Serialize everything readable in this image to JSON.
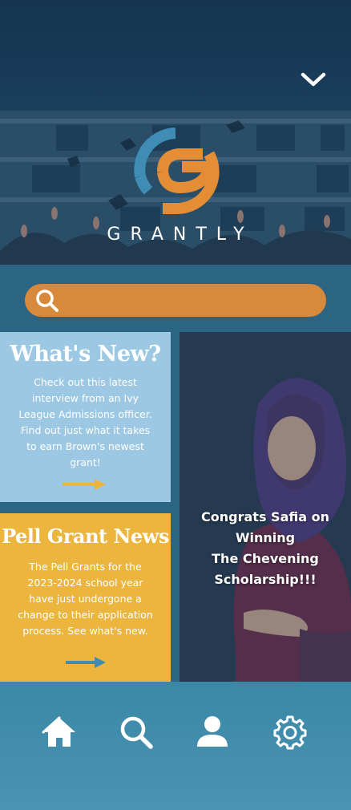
{
  "app": {
    "name": "GRANTLY"
  },
  "header": {
    "menu_icon": "chevron-down-icon"
  },
  "search": {
    "placeholder": "",
    "icon": "search-icon"
  },
  "cards": [
    {
      "title": "What's New?",
      "body": "Check out this latest interview from an Ivy League Admissions officer. Find out just what it takes to earn Brown's newest grant!",
      "arrow_icon": "arrow-right-icon",
      "arrow_color": "#ebb53e"
    },
    {
      "title": "Pell Grant News",
      "body": "The Pell Grants for the 2023-2024 school year have just undergone a change to their application process. See what's new.",
      "arrow_icon": "arrow-right-icon",
      "arrow_color": "#3f8db5"
    }
  ],
  "feature": {
    "line1": "Congrats Safia on",
    "line2": "Winning",
    "line3": "The Chevening",
    "line4": "Scholarship!!!"
  },
  "bottom_nav": [
    {
      "icon": "home-icon"
    },
    {
      "icon": "search-icon"
    },
    {
      "icon": "profile-icon"
    },
    {
      "icon": "settings-icon"
    }
  ],
  "colors": {
    "top_bar": "#16344f",
    "search_bar": "#d88a3c",
    "logo_blue": "#3f8db5",
    "logo_orange": "#e48d35",
    "card_blue": "#9cc8e3",
    "card_yellow": "#ebb53e",
    "bottom_nav": "#4b94b3"
  }
}
